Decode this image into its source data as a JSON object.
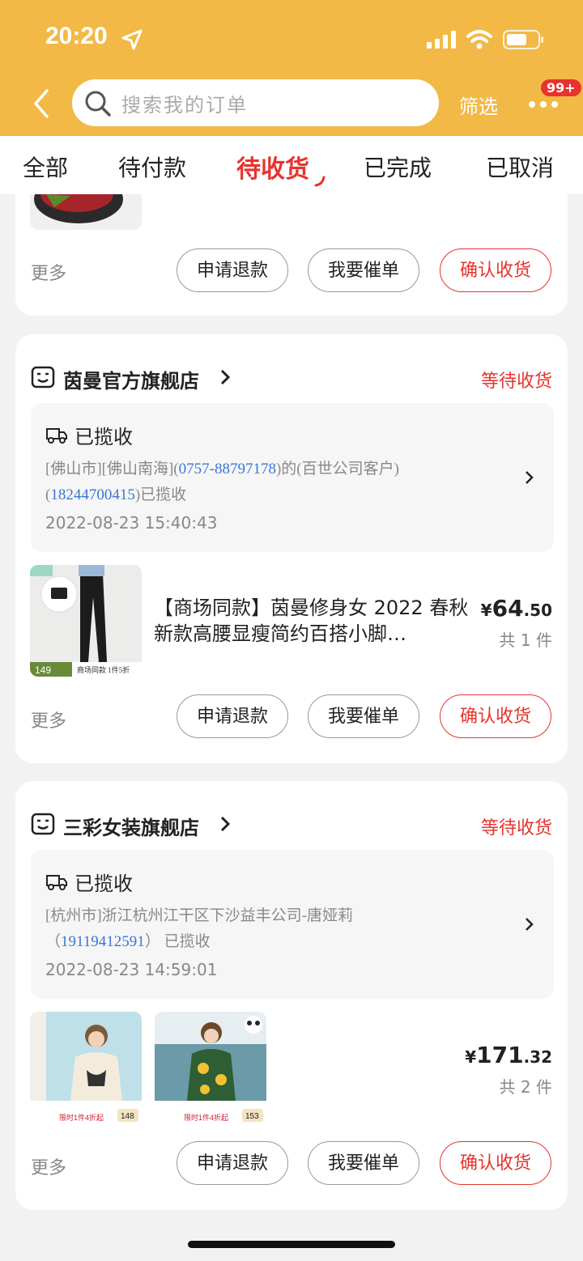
{
  "status_bar": {
    "time": "20:20"
  },
  "header": {
    "search_placeholder": "搜索我的订单",
    "filter_label": "筛选",
    "badge": "99+"
  },
  "tabs": [
    "全部",
    "待付款",
    "待收货",
    "已完成",
    "已取消"
  ],
  "active_tab": "待收货",
  "cards": [
    {
      "more": "更多",
      "actions": [
        "申请退款",
        "我要催单",
        "确认收货"
      ]
    },
    {
      "shop": "茵曼官方旗舰店",
      "status": "等待收货",
      "logistics": {
        "state": "已揽收",
        "line1_a": "[佛山市][佛山南海](",
        "line1_phone": "0757-88797178",
        "line1_b": ")的(百世公司客户)",
        "line2_a": "(",
        "line2_phone": "18244700415",
        "line2_b": ")已揽收",
        "time": "2022-08-23 15:40:43"
      },
      "product": {
        "title": "【商场同款】茵曼修身女 2022 春秋新款高腰显瘦简约百搭小脚…",
        "price_symbol": "¥",
        "price_int": "64",
        "price_dec": ".50",
        "count": "共 1 件",
        "thumb_text": "149",
        "thumb_caption": "商场同款 1件5折"
      },
      "more": "更多",
      "actions": [
        "申请退款",
        "我要催单",
        "确认收货"
      ]
    },
    {
      "shop": "三彩女装旗舰店",
      "status": "等待收货",
      "logistics": {
        "state": "已揽收",
        "line1": "[杭州市]浙江杭州江干区下沙益丰公司-唐娅莉",
        "line2_a": "（",
        "line2_phone": "19119412591",
        "line2_b": "） 已揽收",
        "time": "2022-08-23 14:59:01"
      },
      "product": {
        "price_symbol": "¥",
        "price_int": "171",
        "price_dec": ".32",
        "count": "共 2 件",
        "thumb1_price": "148",
        "thumb2_price": "153",
        "thumb_caption": "限时1件4折起"
      },
      "more": "更多",
      "actions": [
        "申请退款",
        "我要催单",
        "确认收货"
      ]
    }
  ],
  "colors": {
    "header": "#f2b947",
    "accent": "#e8332e",
    "link": "#3a76d6"
  }
}
